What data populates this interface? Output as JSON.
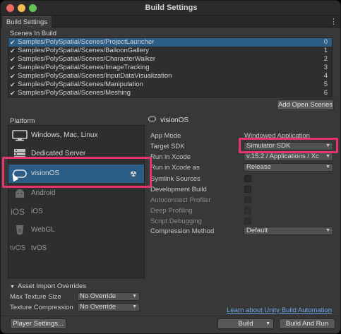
{
  "window": {
    "title": "Build Settings",
    "tab": "Build Settings"
  },
  "scenes": {
    "label": "Scenes In Build",
    "items": [
      {
        "path": "Samples/PolySpatial/Scenes/ProjectLauncher",
        "index": "0",
        "selected": true
      },
      {
        "path": "Samples/PolySpatial/Scenes/BalloonGallery",
        "index": "1"
      },
      {
        "path": "Samples/PolySpatial/Scenes/CharacterWalker",
        "index": "2"
      },
      {
        "path": "Samples/PolySpatial/Scenes/ImageTracking",
        "index": "3"
      },
      {
        "path": "Samples/PolySpatial/Scenes/InputDataVisualization",
        "index": "4"
      },
      {
        "path": "Samples/PolySpatial/Scenes/Manipulation",
        "index": "5"
      },
      {
        "path": "Samples/PolySpatial/Scenes/Meshing",
        "index": "6"
      }
    ],
    "check_glyph": "✔",
    "add_open_scenes": "Add Open Scenes"
  },
  "platform": {
    "label": "Platform",
    "items": [
      {
        "label": "Windows, Mac, Linux",
        "icon": "monitor-icon"
      },
      {
        "label": "Dedicated Server",
        "icon": "server-icon"
      },
      {
        "label": "visionOS",
        "icon": "visionos-icon",
        "selected": true
      },
      {
        "label": "Android",
        "icon": "android-icon"
      },
      {
        "label": "iOS",
        "icon": "ios-icon",
        "icon_text": "iOS"
      },
      {
        "label": "WebGL",
        "icon": "html5-icon"
      },
      {
        "label": "tvOS",
        "icon": "tvos-icon",
        "icon_text": "tvOS"
      }
    ]
  },
  "asset_overrides": {
    "header": "Asset Import Overrides",
    "max_texture_size": {
      "label": "Max Texture Size",
      "value": "No Override"
    },
    "texture_compression": {
      "label": "Texture Compression",
      "value": "No Override"
    }
  },
  "settings": {
    "title": "visionOS",
    "app_mode": {
      "label": "App Mode",
      "value": "Windowed Application"
    },
    "target_sdk": {
      "label": "Target SDK",
      "value": "Simulator SDK"
    },
    "run_in_xcode": {
      "label": "Run in Xcode",
      "value": "v.15.2   / Applications / Xc"
    },
    "run_in_xcode_as": {
      "label": "Run in Xcode as",
      "value": "Release"
    },
    "symlink_sources": {
      "label": "Symlink Sources"
    },
    "development_build": {
      "label": "Development Build"
    },
    "autoconnect_profiler": {
      "label": "Autoconnect Profiler"
    },
    "deep_profiling": {
      "label": "Deep Profiling"
    },
    "script_debugging": {
      "label": "Script Debugging"
    },
    "compression_method": {
      "label": "Compression Method",
      "value": "Default"
    }
  },
  "footer": {
    "learn_link": "Learn about Unity Build Automation",
    "player_settings": "Player Settings...",
    "build": "Build",
    "build_and_run": "Build And Run"
  },
  "colors": {
    "highlight": "#e8336b",
    "selection": "#2c5d87",
    "link": "#6fa3e8"
  }
}
